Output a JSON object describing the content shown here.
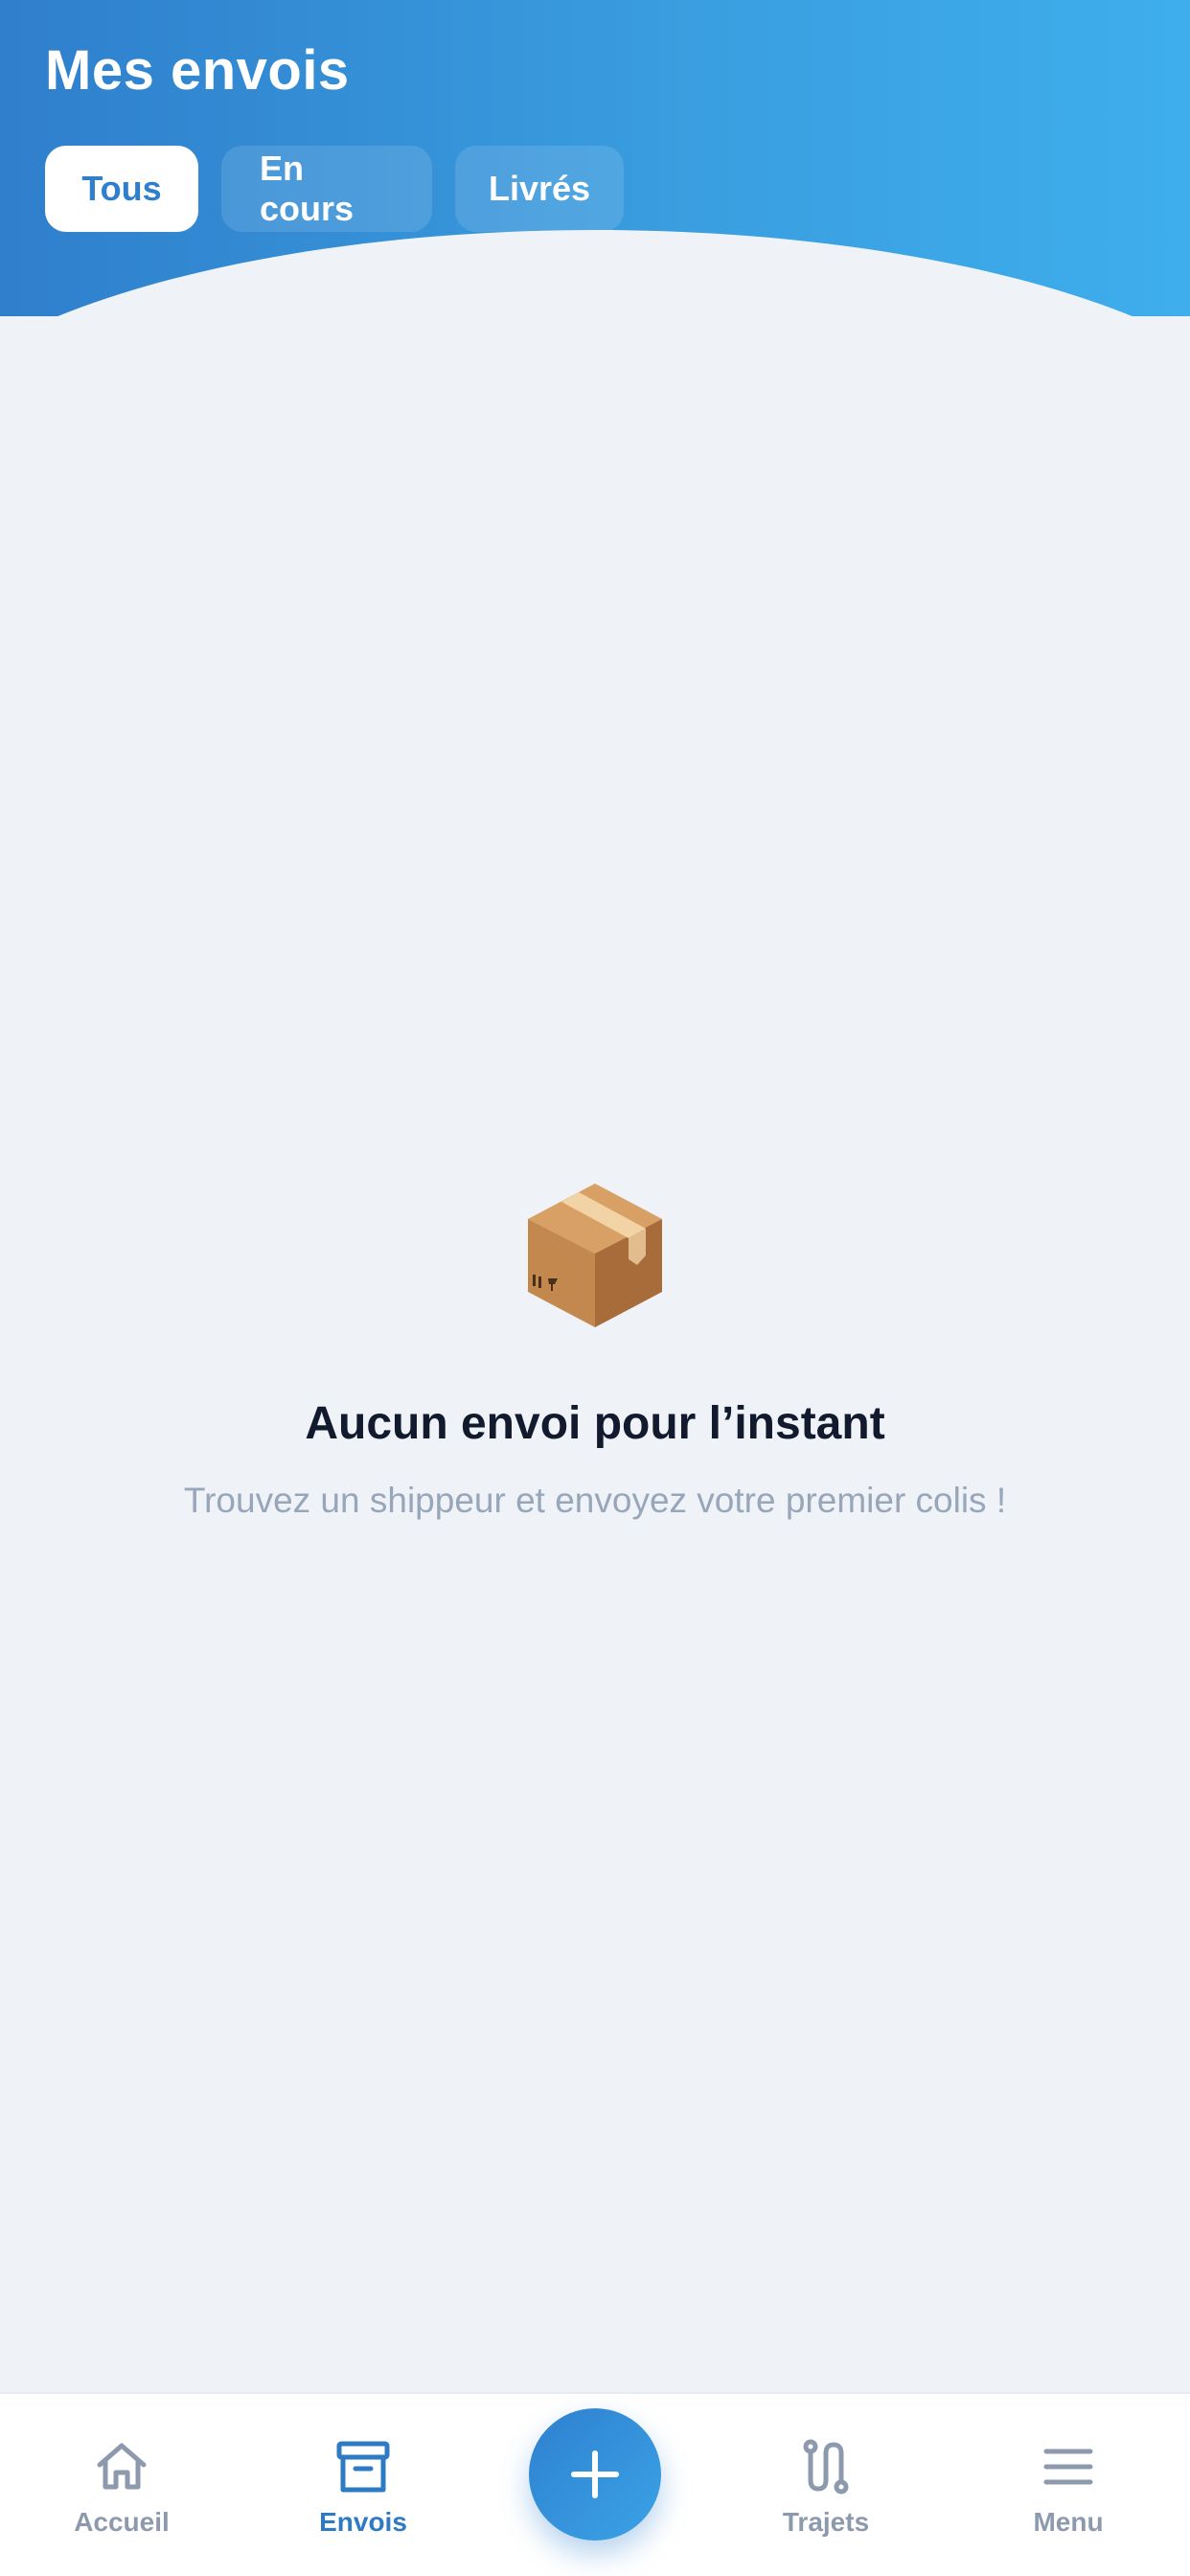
{
  "header": {
    "title": "Mes envois",
    "tabs": [
      {
        "label": "Tous",
        "active": true
      },
      {
        "label": "En cours",
        "active": false
      },
      {
        "label": "Livrés",
        "active": false
      }
    ]
  },
  "empty_state": {
    "icon": "package-box-icon",
    "title": "Aucun envoi pour l’instant",
    "subtitle": "Trouvez un shippeur et envoyez votre premier colis !"
  },
  "bottom_nav": {
    "items": [
      {
        "label": "Accueil",
        "icon": "home-icon",
        "active": false
      },
      {
        "label": "Envois",
        "icon": "archive-box-icon",
        "active": true
      },
      {
        "label": "Trajets",
        "icon": "route-icon",
        "active": false
      },
      {
        "label": "Menu",
        "icon": "menu-icon",
        "active": false
      }
    ],
    "fab_icon": "plus-icon"
  },
  "colors": {
    "primary": "#2f7fcc",
    "primary_light": "#3eaeec",
    "background": "#eff3f8",
    "title_text": "#121a2e",
    "muted_text": "#98a6ba",
    "inactive_nav": "#8d9aae"
  }
}
